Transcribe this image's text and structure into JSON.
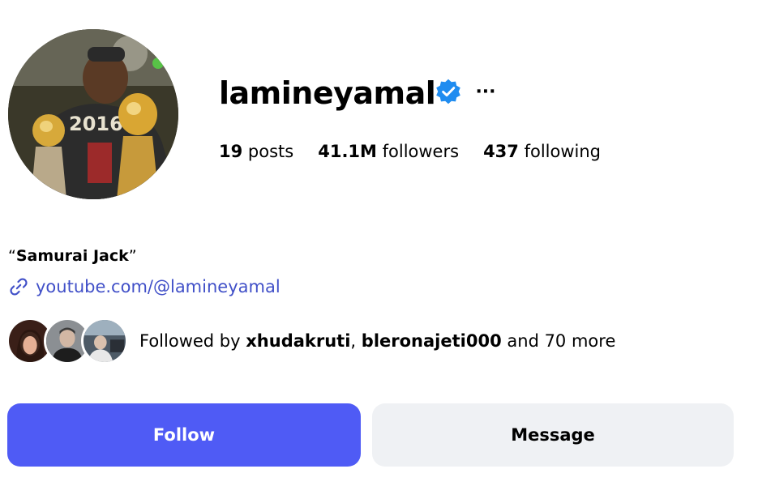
{
  "profile": {
    "username": "lamineyamal",
    "verified": true,
    "more_icon": "more-horizontal-icon"
  },
  "stats": {
    "posts": {
      "count": "19",
      "label": "posts"
    },
    "followers": {
      "count": "41.1M",
      "label": "followers"
    },
    "following": {
      "count": "437",
      "label": "following"
    }
  },
  "bio": {
    "open_quote": "“",
    "name": "Samurai Jack",
    "close_quote": "”",
    "link_icon": "link-icon",
    "link_text": "youtube.com/@lamineyamal"
  },
  "followed_by": {
    "prefix": "Followed by",
    "user1": "xhudakruti",
    "separator": ",",
    "user2": "bleronajeti000",
    "suffix": "and 70 more"
  },
  "actions": {
    "follow_label": "Follow",
    "message_label": "Message"
  },
  "colors": {
    "accent": "#4f5bf5",
    "link": "#4150c8",
    "verified": "#1f8cf0",
    "secondary_button": "#eff1f4"
  }
}
